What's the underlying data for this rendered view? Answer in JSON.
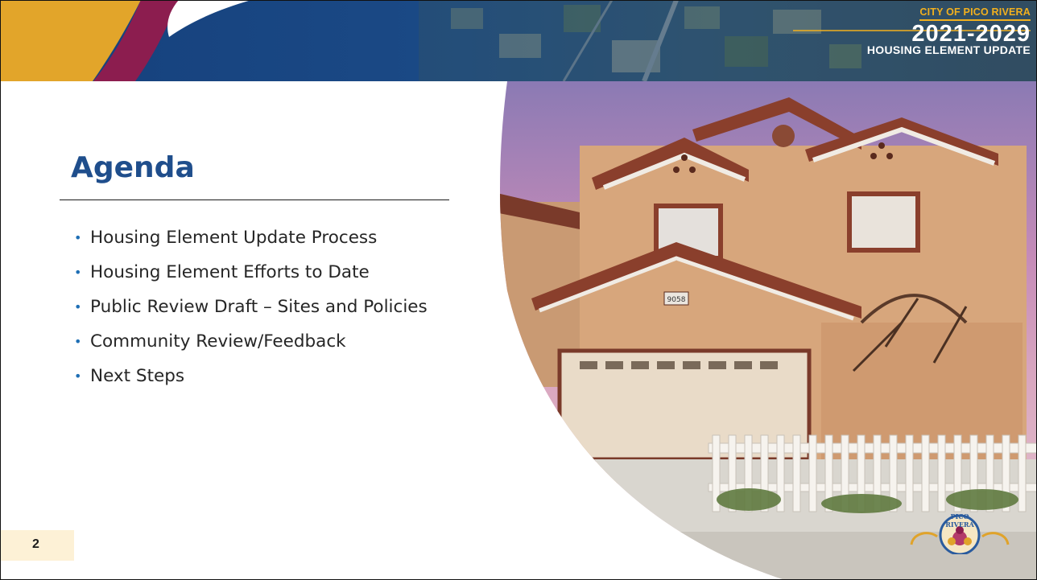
{
  "header": {
    "city": "CITY OF PICO RIVERA",
    "years": "2021-2029",
    "subtitle": "HOUSING ELEMENT UPDATE"
  },
  "slide": {
    "title": "Agenda",
    "agenda_items": [
      "Housing Element Update Process",
      "Housing Element Efforts to Date",
      "Public Review Draft – Sites and Policies",
      "Community Review/Feedback",
      "Next Steps"
    ],
    "page_number": "2"
  },
  "photo": {
    "house_number": "9058"
  },
  "logo": {
    "text": "PICO RIVERA"
  },
  "colors": {
    "banner_blue": "#173f7a",
    "accent_yellow": "#e2a52a",
    "accent_maroon": "#8c1d4f",
    "title_blue": "#1f4e8c",
    "bullet_blue": "#1f6fb5",
    "page_num_bg": "#fdf1d6"
  }
}
